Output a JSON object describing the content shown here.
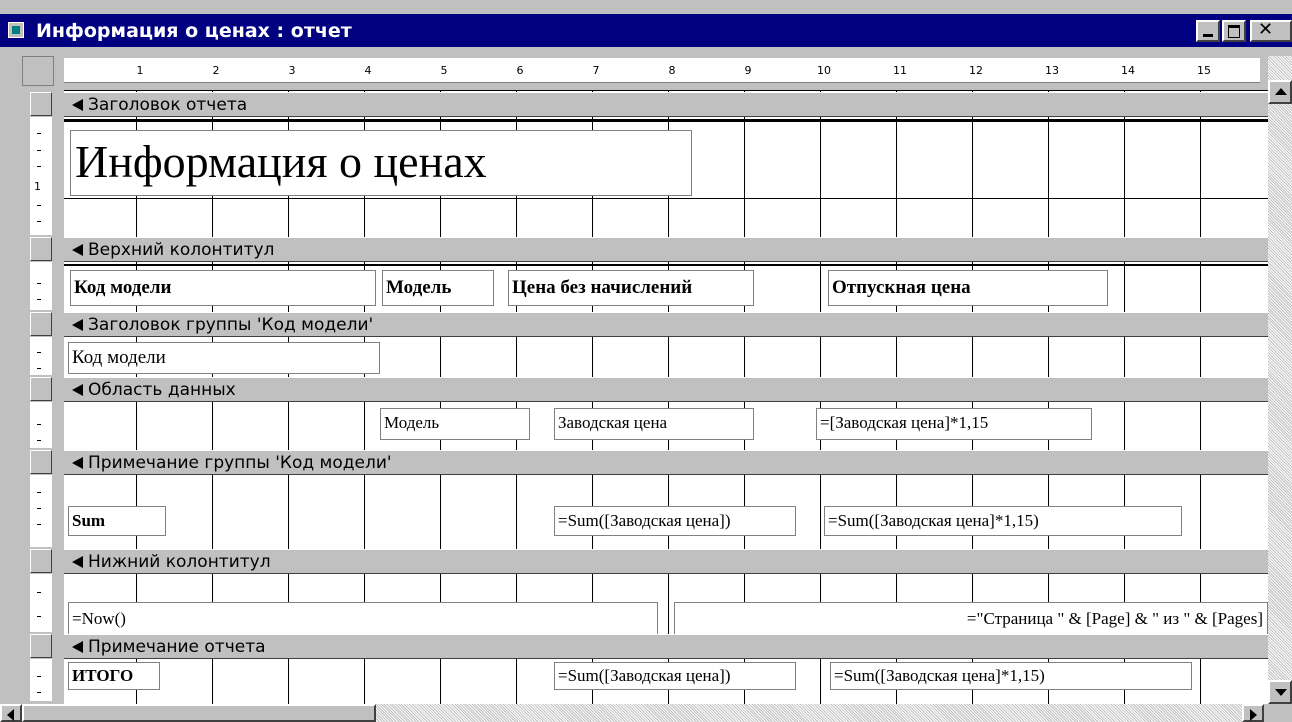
{
  "window": {
    "title": "Информация о ценах : отчет"
  },
  "ruler": {
    "numbers": [
      "1",
      "2",
      "3",
      "4",
      "5",
      "6",
      "7",
      "8",
      "9",
      "10",
      "11",
      "12",
      "13",
      "14",
      "15"
    ],
    "vertical_number": "1"
  },
  "sections": {
    "report_header": {
      "label": "Заголовок отчета",
      "title_text": "Информация о ценах"
    },
    "page_header": {
      "label": "Верхний колонтитул",
      "col_code": "Код модели",
      "col_model": "Модель",
      "col_price": "Цена без начислений",
      "col_sale": "Отпускная цена"
    },
    "group_header": {
      "label": "Заголовок группы 'Код модели'",
      "field_code": "Код модели"
    },
    "detail": {
      "label": "Область данных",
      "field_model": "Модель",
      "field_factory": "Заводская цена",
      "field_expr": "=[Заводская цена]*1,15"
    },
    "group_footer": {
      "label": "Примечание группы 'Код модели'",
      "sum_label": "Sum",
      "sum_factory": "=Sum([Заводская цена])",
      "sum_expr": "=Sum([Заводская цена]*1,15)"
    },
    "page_footer": {
      "label": "Нижний колонтитул",
      "now": "=Now()",
      "pages": "=\"Страница \" & [Page] & \" из \" & [Pages]"
    },
    "report_footer": {
      "label": "Примечание отчета",
      "total_label": "ИТОГО",
      "sum_factory": "=Sum([Заводская цена])",
      "sum_expr": "=Sum([Заводская цена]*1,15)"
    }
  },
  "icons": [
    "report-icon",
    "minimize-icon",
    "maximize-icon",
    "close-icon",
    "section-arrow-icon",
    "scroll-up-icon",
    "scroll-down-icon",
    "scroll-left-icon",
    "scroll-right-icon"
  ],
  "colors": {
    "titlebar": "#000080",
    "section_bar": "#c0c0c0"
  }
}
